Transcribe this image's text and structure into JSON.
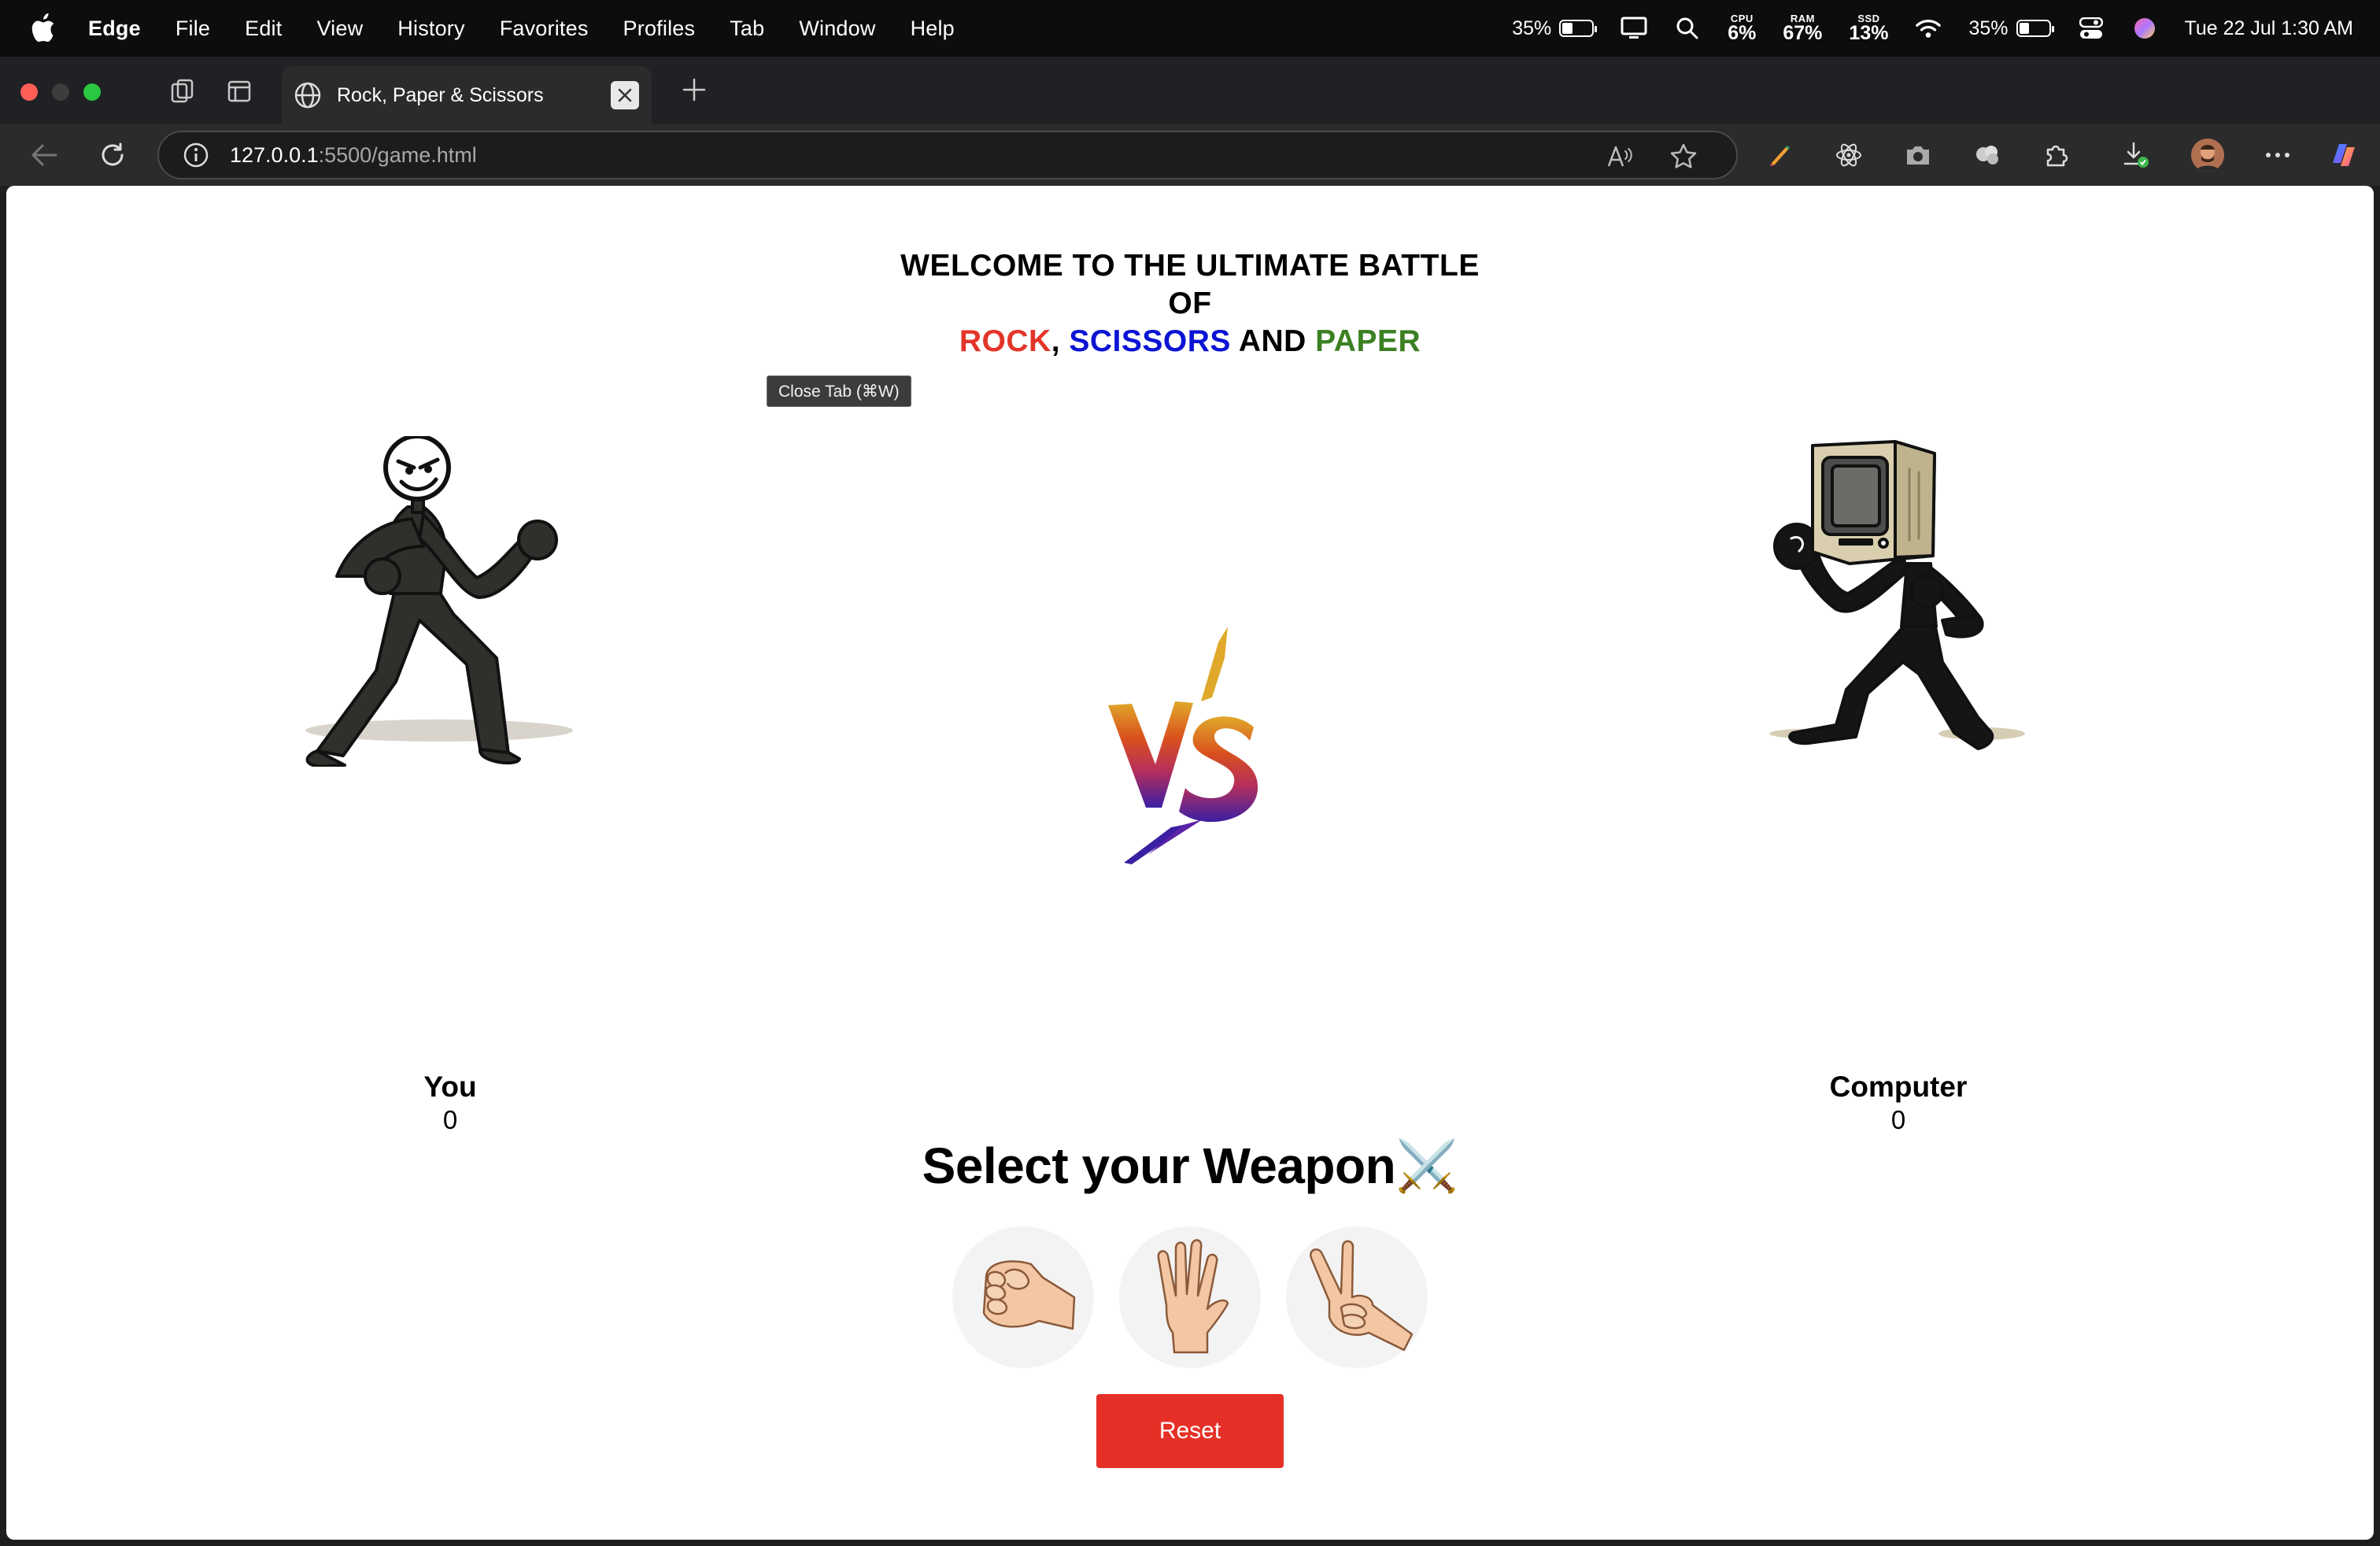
{
  "menubar": {
    "app_name": "Edge",
    "menus": [
      "File",
      "Edit",
      "View",
      "History",
      "Favorites",
      "Profiles",
      "Tab",
      "Window",
      "Help"
    ],
    "battery1": "35%",
    "cpu": {
      "label": "CPU",
      "value": "6%"
    },
    "ram": {
      "label": "RAM",
      "value": "67%"
    },
    "ssd": {
      "label": "SSD",
      "value": "13%"
    },
    "battery2": "35%",
    "datetime": "Tue 22 Jul  1:30 AM",
    "battery_level": 0.35
  },
  "browser": {
    "tab_title": "Rock, Paper & Scissors",
    "url_host": "127.0.0.1",
    "url_rest": ":5500/game.html",
    "tooltip": "Close Tab (⌘W)"
  },
  "game": {
    "title_line1": "WELCOME TO THE ULTIMATE BATTLE",
    "title_line2": "OF",
    "rock": "ROCK",
    "comma": ", ",
    "scissors": "SCISSORS",
    "and": " AND ",
    "paper": "PAPER",
    "vs": "VS",
    "player_label": "You",
    "player_score": "0",
    "computer_label": "Computer",
    "computer_score": "0",
    "select_title": "Select your Weapon⚔️",
    "choices": [
      "rock",
      "paper",
      "scissors"
    ],
    "reset_label": "Reset"
  },
  "colors": {
    "rock": "#e33529",
    "scissors": "#0b14d3",
    "paper": "#3b8022",
    "reset": "#e63027"
  }
}
